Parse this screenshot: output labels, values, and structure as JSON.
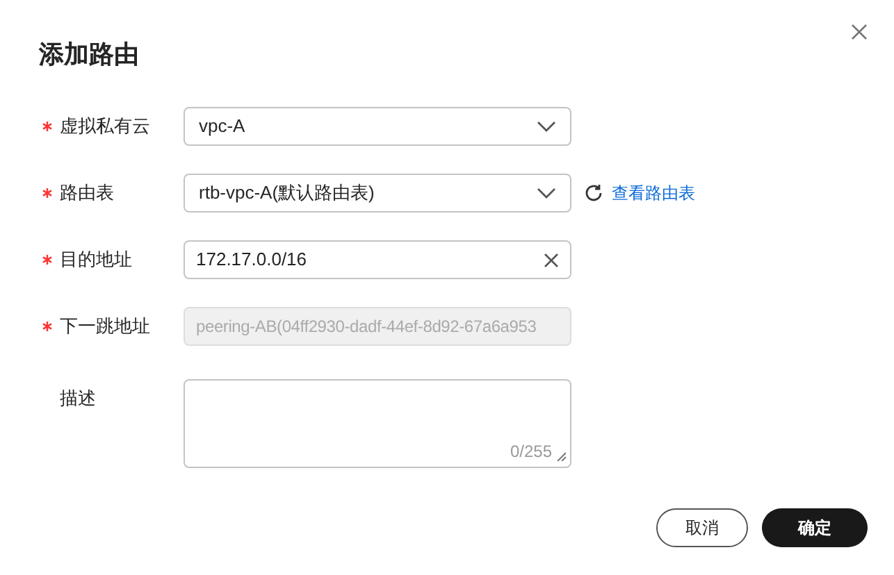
{
  "dialog": {
    "title": "添加路由"
  },
  "fields": [
    {
      "kind": "select",
      "label": "虚拟私有云",
      "required": true,
      "value": "vpc-A",
      "disabled": false
    },
    {
      "kind": "select",
      "label": "路由表",
      "required": true,
      "value": "rtb-vpc-A(默认路由表)",
      "disabled": false,
      "link": "查看路由表"
    },
    {
      "kind": "input",
      "label": "目的地址",
      "required": true,
      "value": "172.17.0.0/16",
      "disabled": false
    },
    {
      "kind": "input",
      "label": "下一跳地址",
      "required": true,
      "value": "peering-AB(04ff2930-dadf-44ef-8d92-67a6a953",
      "disabled": true
    },
    {
      "kind": "textarea",
      "label": "描述",
      "required": false,
      "counter": "0/255",
      "disabled": false
    }
  ],
  "buttons": [
    {
      "label": "取消",
      "primary": false
    },
    {
      "label": "确定",
      "primary": true
    }
  ]
}
